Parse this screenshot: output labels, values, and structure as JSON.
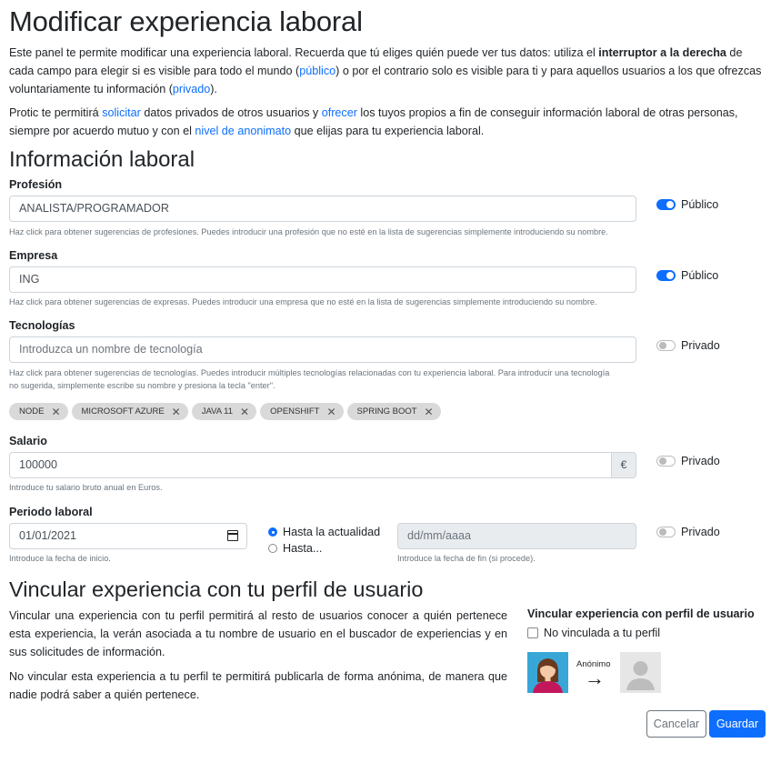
{
  "page_title": "Modificar experiencia laboral",
  "intro": {
    "p1_a": "Este panel te permite modificar una experiencia laboral. Recuerda que tú eliges quién puede ver tus datos: utiliza el ",
    "p1_bold": "interruptor a la derecha",
    "p1_b": " de cada campo para elegir si es visible para todo el mundo (",
    "p1_link_public": "público",
    "p1_c": ") o por el contrario solo es visible para ti y para aquellos usuarios a los que ofrezcas voluntariamente tu información (",
    "p1_link_private": "privado",
    "p1_d": ").",
    "p2_a": "Protic te permitirá ",
    "p2_link_request": "solicitar",
    "p2_b": " datos privados de otros usuarios y ",
    "p2_link_offer": "ofrecer",
    "p2_c": " los tuyos propios a fin de conseguir información laboral de otras personas, siempre por acuerdo mutuo y con el ",
    "p2_link_anon": "nivel de anonimato",
    "p2_d": " que elijas para tu experiencia laboral."
  },
  "section_work": "Información laboral",
  "profession": {
    "label": "Profesión",
    "value": "ANALISTA/PROGRAMADOR",
    "help": "Haz click para obtener sugerencias de profesiones. Puedes introducir una profesión que no esté en la lista de sugerencias simplemente introduciendo su nombre.",
    "visibility": "Público"
  },
  "company": {
    "label": "Empresa",
    "value": "ING",
    "help": "Haz click para obtener sugerencias de expresas. Puedes introducir una empresa que no esté en la lista de sugerencias simplemente introduciendo su nombre.",
    "visibility": "Público"
  },
  "technologies": {
    "label": "Tecnologías",
    "placeholder": "Introduzca un nombre de tecnología",
    "help_1": "Haz click para obtener sugerencias de tecnologías. Puedes introducir múltiples tecnologías relacionadas con tu experiencia laboral. Para introducir una tecnología",
    "help_2": "no sugerida, simplemente escribe su nombre y presiona la tecla \"enter\".",
    "visibility": "Privado",
    "tags": [
      "NODE",
      "MICROSOFT AZURE",
      "JAVA 11",
      "OPENSHIFT",
      "SPRING BOOT"
    ]
  },
  "salary": {
    "label": "Salario",
    "value": "100000",
    "currency": "€",
    "help": "Introduce tu salario bruto anual en Euros.",
    "visibility": "Privado"
  },
  "period": {
    "label": "Periodo laboral",
    "start_value": "01/01/2021",
    "start_help": "Introduce la fecha de inicio.",
    "radio_current": "Hasta la actualidad",
    "radio_until": "Hasta...",
    "end_placeholder": "dd/mm/aaaa",
    "end_help": "Introduce la fecha de fin (si procede).",
    "visibility": "Privado"
  },
  "section_link": "Vincular experiencia con tu perfil de usuario",
  "link": {
    "p1": "Vincular una experiencia con tu perfil permitirá al resto de usuarios conocer a quién pertenece esta experiencia, la verán asociada a tu nombre de usuario en el buscador de experiencias y en sus solicitudes de información.",
    "p2": "No vincular esta experiencia a tu perfil te permitirá publicarla de forma anónima, de manera que nadie podrá saber a quién pertenece.",
    "box_title": "Vincular experiencia con perfil de usuario",
    "checkbox_label": "No vinculada a tu perfil",
    "anon_label": "Anónimo",
    "arrow": "→"
  },
  "buttons": {
    "cancel": "Cancelar",
    "save": "Guardar"
  },
  "colors": {
    "primary": "#0d6efd",
    "muted": "#6c757d",
    "chip_bg": "#d9d9d9"
  }
}
